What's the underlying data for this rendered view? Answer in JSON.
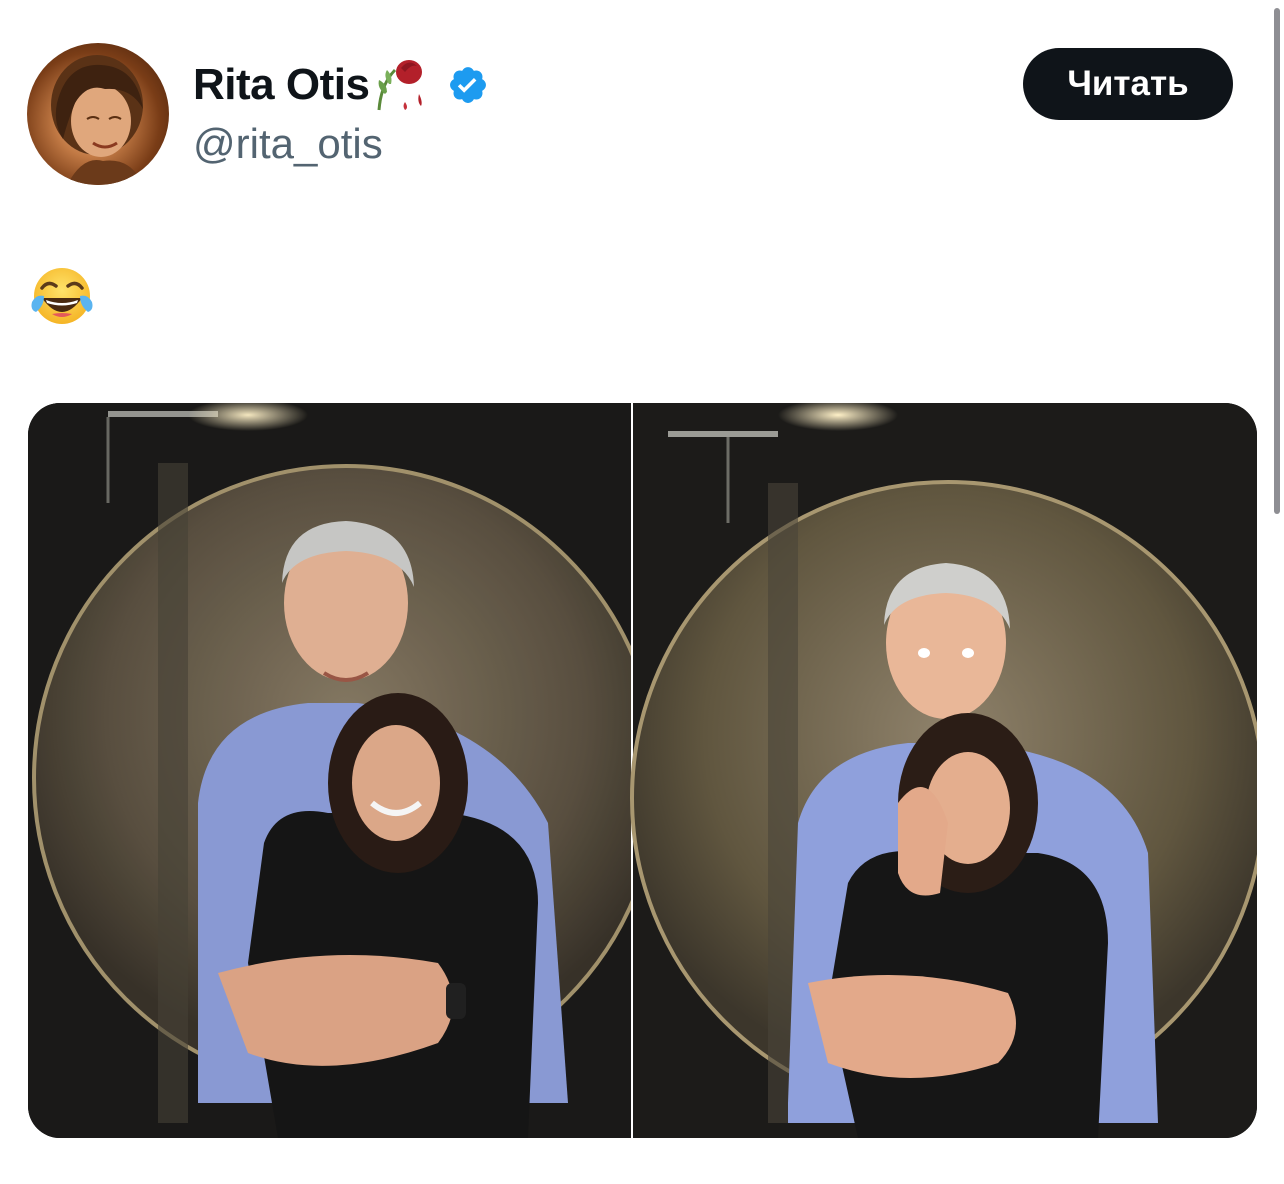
{
  "tweet": {
    "author": {
      "display_name": "Rita Otis",
      "handle": "@rita_otis",
      "name_emoji_icon": "wilted-rose-icon",
      "verified_icon": "verified-badge-icon",
      "verified_color": "#1d9bf0"
    },
    "follow_button": {
      "label": "Читать",
      "background": "#0f1419",
      "text_color": "#ffffff"
    },
    "text_emoji_icon": "face-with-tears-of-joy-icon",
    "media": {
      "photo_count": 2,
      "photos": [
        {
          "description_icon": "photo-couple-smiling"
        },
        {
          "description_icon": "photo-couple-woman-covering-face"
        }
      ]
    }
  },
  "colors": {
    "text_primary": "#0f1419",
    "text_secondary": "#536471",
    "accent": "#1d9bf0"
  }
}
